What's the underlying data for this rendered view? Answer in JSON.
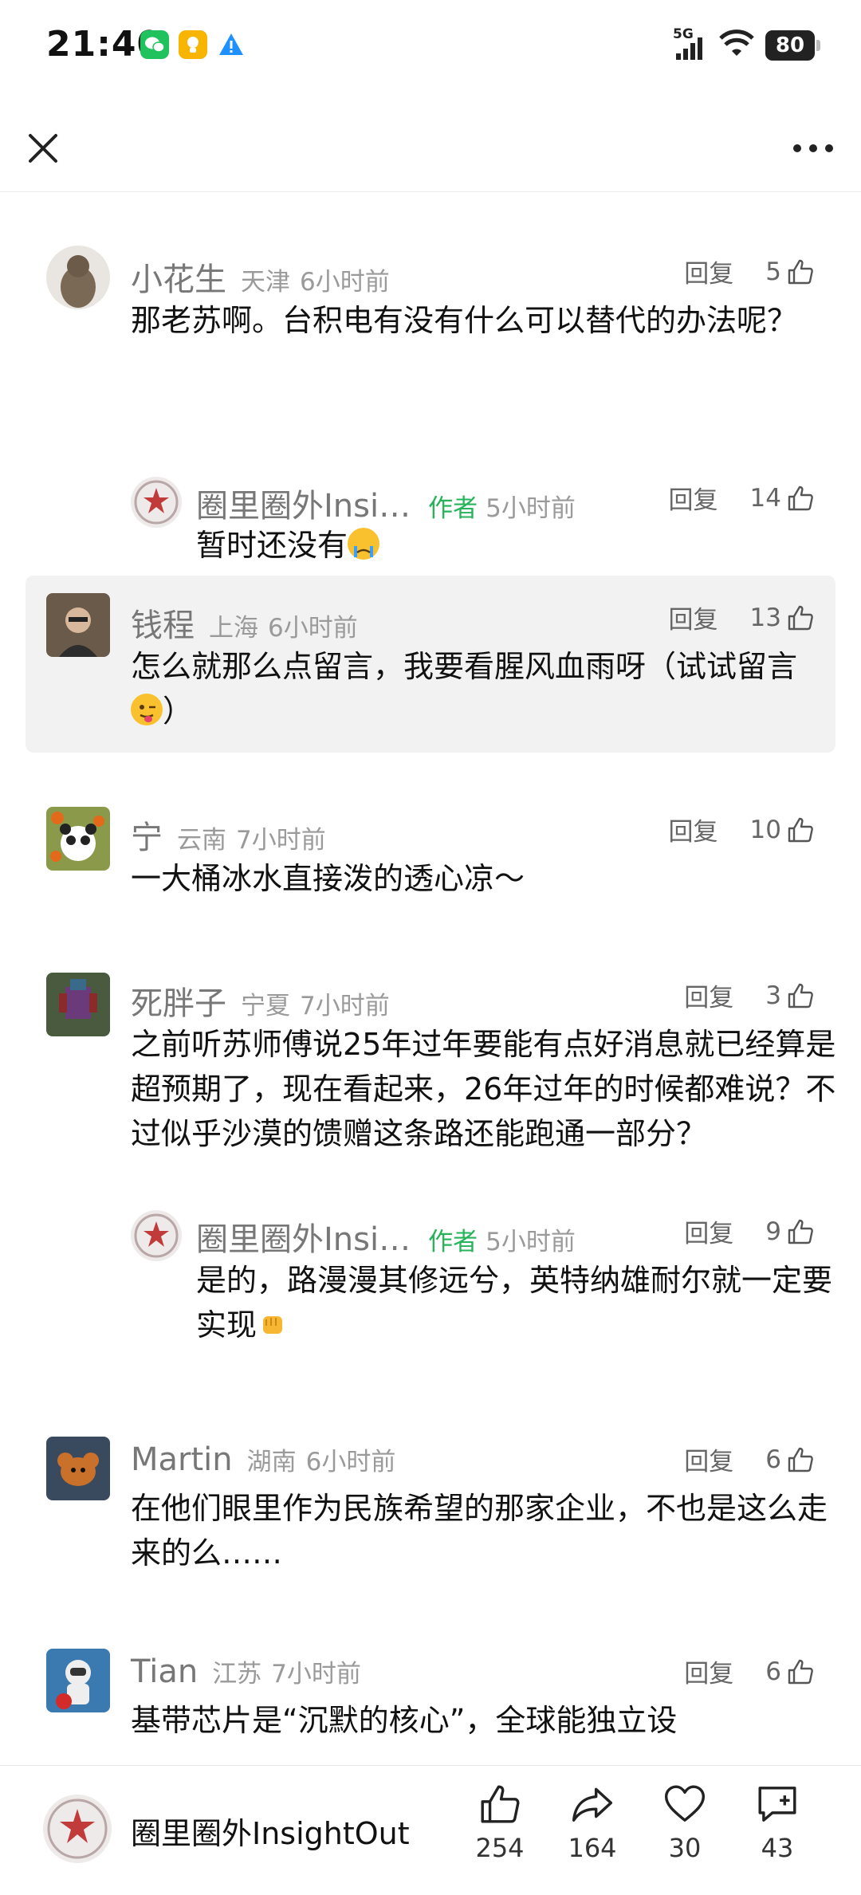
{
  "status": {
    "time": "21:40",
    "network": "5G",
    "battery": "80"
  },
  "nav": {
    "close_icon": "close-icon",
    "more_icon": "more-horizontal-icon"
  },
  "comments": [
    {
      "user": "小花生",
      "location": "天津",
      "time": "6小时前",
      "reply": "回复",
      "likes": "5",
      "text": "那老苏啊。台积电有没有什么可以替代的办法呢？",
      "replies": [
        {
          "user": "圈里圈外Insi…",
          "tag": "作者",
          "time": "5小时前",
          "reply": "回复",
          "likes": "14",
          "text": "暂时还没有",
          "emoji": "crying-face"
        }
      ]
    },
    {
      "user": "钱程",
      "location": "上海",
      "time": "6小时前",
      "reply": "回复",
      "likes": "13",
      "text": "怎么就那么点留言，我要看腥风血雨呀（试试留言",
      "emoji": "winking-tongue-face",
      "text_end": "）",
      "highlighted": true
    },
    {
      "user": "宁",
      "location": "云南",
      "time": "7小时前",
      "reply": "回复",
      "likes": "10",
      "text": "一大桶冰水直接泼的透心凉～"
    },
    {
      "user": "死胖子",
      "location": "宁夏",
      "time": "7小时前",
      "reply": "回复",
      "likes": "3",
      "text": "之前听苏师傅说25年过年要能有点好消息就已经算是超预期了，现在看起来，26年过年的时候都难说？不过似乎沙漠的馈赠这条路还能跑通一部分？",
      "replies": [
        {
          "user": "圈里圈外Insi…",
          "tag": "作者",
          "time": "5小时前",
          "reply": "回复",
          "likes": "9",
          "text": "是的，路漫漫其修远兮，英特纳雄耐尔就一定要实现",
          "emoji": "raised-fist"
        }
      ]
    },
    {
      "user": "Martin",
      "location": "湖南",
      "time": "6小时前",
      "reply": "回复",
      "likes": "6",
      "text": "在他们眼里作为民族希望的那家企业，不也是这么走来的么……"
    },
    {
      "user": "Tian",
      "location": "江苏",
      "time": "7小时前",
      "reply": "回复",
      "likes": "6",
      "text": "基带芯片是“沉默的核心”，全球能独立设"
    }
  ],
  "bottom": {
    "account": "圈里圈外InsightOut",
    "like_count": "254",
    "share_count": "164",
    "fav_count": "30",
    "comment_count": "43"
  },
  "colors": {
    "author_tag": "#26b35a",
    "highlight_bg": "#f2f2f2"
  }
}
